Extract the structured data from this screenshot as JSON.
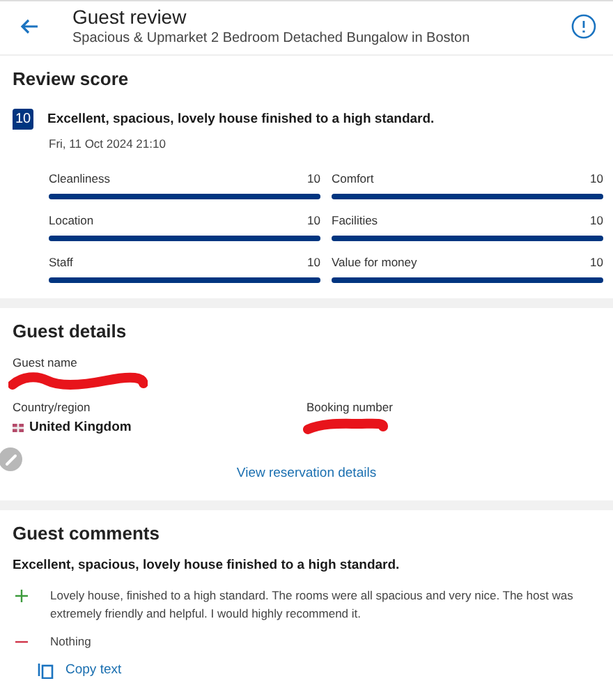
{
  "header": {
    "title": "Guest review",
    "subtitle": "Spacious & Upmarket 2 Bedroom Detached Bungalow in Boston"
  },
  "review_score": {
    "heading": "Review score",
    "score": "10",
    "headline": "Excellent, spacious, lovely house finished to a high standard.",
    "date": "Fri, 11 Oct 2024 21:10",
    "categories": [
      {
        "label": "Cleanliness",
        "value": "10",
        "level": 1
      },
      {
        "label": "Comfort",
        "value": "10",
        "level": 1
      },
      {
        "label": "Location",
        "value": "10",
        "level": 1
      },
      {
        "label": "Facilities",
        "value": "10",
        "level": 1
      },
      {
        "label": "Staff",
        "value": "10",
        "level": 1
      },
      {
        "label": "Value for money",
        "value": "10",
        "level": 1
      }
    ]
  },
  "guest_details": {
    "heading": "Guest details",
    "guest_name_label": "Guest name",
    "country_label": "Country/region",
    "country": "United Kingdom",
    "booking_number_label": "Booking number",
    "link": "View reservation details"
  },
  "guest_comments": {
    "heading": "Guest comments",
    "title": "Excellent, spacious, lovely house finished to a high standard.",
    "items": [
      {
        "kind": "positive",
        "text": "Lovely house, finished to a high standard. The rooms were all spacious and very nice. The host was extremely friendly and helpful. I would highly recommend it."
      },
      {
        "kind": "negative",
        "text": "Nothing"
      }
    ],
    "copy_button": "Copy text"
  }
}
